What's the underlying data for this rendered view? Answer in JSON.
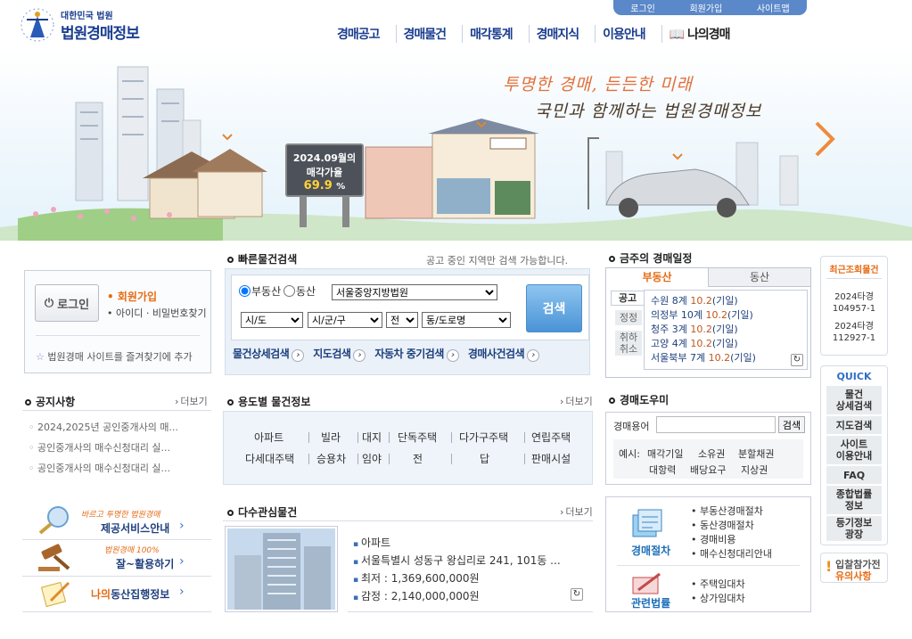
{
  "header": {
    "logo_top": "대한민국 법원",
    "logo_main": "법원경매정보",
    "util": [
      "로그인",
      "회원가입",
      "사이트맵"
    ],
    "gnb": [
      "경매공고",
      "경매물건",
      "매각통계",
      "경매지식",
      "이용안내",
      "나의경매"
    ]
  },
  "hero": {
    "slogan1": "투명한 경매, 든든한 미래",
    "slogan2": "국민과 함께하는 법원경매정보",
    "sign_line1": "2024.09월의",
    "sign_line2": "매각가율",
    "sign_value": "69.9",
    "sign_unit": "%"
  },
  "login": {
    "button": "로그인",
    "join": "회원가입",
    "find": "아이디 · 비밀번호찾기",
    "favorite": "법원경매 사이트를 즐겨찾기에 추가"
  },
  "quick_search": {
    "title": "빠른물건검색",
    "hint": "공고 중인 지역만 검색 가능합니다.",
    "radio_realestate": "부동산",
    "radio_movable": "동산",
    "court": "서울중앙지방법원",
    "sido": "시/도",
    "sigungu": "시/군/구",
    "jeon": "전",
    "dong": "동/도로명",
    "search_button": "검색",
    "links": [
      "물건상세검색",
      "지도검색",
      "자동차 중기검색",
      "경매사건검색"
    ]
  },
  "schedule": {
    "title": "금주의 경매일정",
    "tab_realestate": "부동산",
    "tab_movable": "동산",
    "side": [
      "공고",
      "정정",
      "취하",
      "취소"
    ],
    "items": [
      {
        "court": "수원 8계",
        "date": "10.2",
        "type": "(기일)"
      },
      {
        "court": "의정부 10계",
        "date": "10.2",
        "type": "(기일)"
      },
      {
        "court": "청주 3계",
        "date": "10.2",
        "type": "(기일)"
      },
      {
        "court": "고양 4계",
        "date": "10.2",
        "type": "(기일)"
      },
      {
        "court": "서울북부 7계",
        "date": "10.2",
        "type": "(기일)"
      }
    ]
  },
  "recent": {
    "title": "최근조회물건",
    "items": [
      "2024타경\n104957-1",
      "2024타경\n112927-1"
    ]
  },
  "quick": {
    "title": "QUICK",
    "items": [
      "물건\n상세검색",
      "지도검색",
      "사이트\n이용안내",
      "FAQ",
      "종합법률\n정보",
      "등기정보\n광장"
    ],
    "notice_line1": "입찰참가전",
    "notice_line2": "유의사항"
  },
  "notices": {
    "title": "공지사항",
    "more": "더보기",
    "items": [
      "2024,2025년 공인중개사의 매...",
      "공인중개사의 매수신청대리 실...",
      "공인중개사의 매수신청대리 실..."
    ]
  },
  "category": {
    "title": "용도별 물건정보",
    "more": "더보기",
    "row1": [
      "아파트",
      "빌라",
      "대지",
      "단독주택",
      "다가구주택",
      "연립주택"
    ],
    "row2": [
      "다세대주택",
      "승용차",
      "임야",
      "전",
      "답",
      "판매시설"
    ]
  },
  "dictionary": {
    "title": "경매도우미",
    "label": "경매용어",
    "button": "검색",
    "example": "예시:",
    "terms1": [
      "매각기일",
      "소유권",
      "분할채권"
    ],
    "terms2": [
      "대항력",
      "배당요구",
      "지상권"
    ]
  },
  "promos": [
    {
      "tag": "바르고 투명한 법원경매",
      "label": "제공서비스안내"
    },
    {
      "tag": "법원경매 100%",
      "label": "잘~활용하기"
    },
    {
      "tag": "",
      "label_a": "나의",
      "label_b": "동산집행정보"
    }
  ],
  "popular": {
    "title": "다수관심물건",
    "more": "더보기",
    "type": "아파트",
    "address": "서울특별시 성동구 왕십리로 241, 101동 ...",
    "min_price": "최저 : 1,369,600,000원",
    "appraisal": "감정 : 2,140,000,000원"
  },
  "procedure": {
    "title1": "경매절차",
    "items1": [
      "부동산경매절차",
      "동산경매절차",
      "경매비용",
      "매수신청대리안내"
    ],
    "title2": "관련법률",
    "items2": [
      "주택임대차",
      "상가임대차"
    ]
  },
  "colors": {
    "primary": "#1a3d8f",
    "accent": "#e66b14",
    "date": "#c0571b"
  }
}
